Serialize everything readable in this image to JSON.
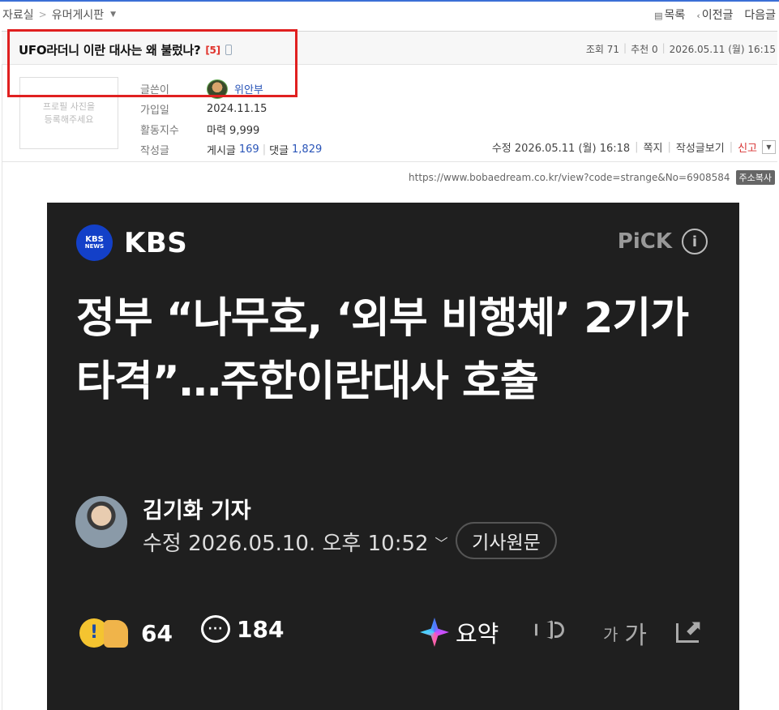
{
  "breadcrumb": {
    "root": "자료실",
    "separator": ">",
    "board": "유머게시판"
  },
  "topnav": {
    "list": "목록",
    "prev": "이전글",
    "next": "다음글"
  },
  "post": {
    "title": "UFO라더니 이란 대사는 왜 불렀나?",
    "comment_count": "[5]",
    "views_label": "조회 71",
    "recommend_label": "추천 0",
    "date": "2026.05.11 (월) 16:15"
  },
  "author": {
    "photo_placeholder_line1": "프로필 사진을",
    "photo_placeholder_line2": "등록해주세요",
    "name_label": "글쓴이",
    "name": "위안부",
    "joined_label": "가입일",
    "joined": "2024.11.15",
    "activity_label": "활동지수",
    "activity": "마력 9,999",
    "posts_label": "작성글",
    "posts_prefix": "게시글",
    "posts_count": "169",
    "comments_prefix": "댓글",
    "comments_count": "1,829"
  },
  "post_actions": {
    "edited": "수정 2026.05.11 (월) 16:18",
    "message": "쪽지",
    "view_posts": "작성글보기",
    "report": "신고"
  },
  "url": {
    "text": "https://www.bobaedream.co.kr/view?code=strange&No=6908584",
    "copy": "주소복사"
  },
  "article": {
    "logo_top": "KBS",
    "logo_bottom": "NEWS",
    "brand": "KBS",
    "pick": "PiCK",
    "headline": "정부 “나무호, ‘외부 비행체’ 2기가 타격”…주한이란대사 호출",
    "reporter": "김기화 기자",
    "updated": "수정 2026.05.10. 오후 10:52",
    "original_button": "기사원문",
    "reactions": "64",
    "comments": "184",
    "summary": "요약",
    "font_big": "가",
    "font_small": "가"
  }
}
